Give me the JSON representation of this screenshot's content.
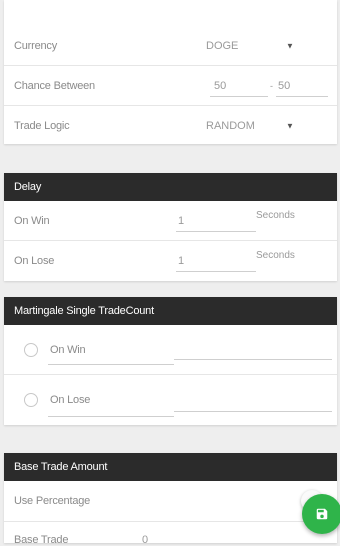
{
  "trade_settings": {
    "currency_label": "Currency",
    "currency_value": "DOGE",
    "chance_label": "Chance Between",
    "chance_from": "50",
    "chance_separator": "-",
    "chance_to": "50",
    "logic_label": "Trade Logic",
    "logic_value": "RANDOM"
  },
  "delay": {
    "title": "Delay",
    "on_win_label": "On Win",
    "on_win_value": "1",
    "on_win_unit": "Seconds",
    "on_lose_label": "On Lose",
    "on_lose_value": "1",
    "on_lose_unit": "Seconds"
  },
  "martingale": {
    "title": "Martingale Single TradeCount",
    "on_win_label": "On Win",
    "on_lose_label": "On Lose"
  },
  "base_trade": {
    "title": "Base Trade Amount",
    "use_percentage_label": "Use Percentage",
    "base_trade_label": "Base Trade",
    "base_trade_value": "0"
  },
  "colors": {
    "header_bg": "#2b2b2b",
    "fab_bg": "#2fb44a"
  },
  "icons": {
    "dropdown": "caret-down-icon",
    "fab": "save-icon"
  }
}
